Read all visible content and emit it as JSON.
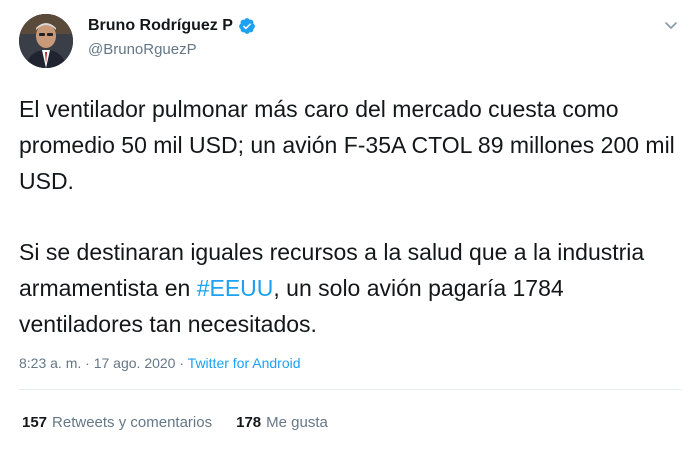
{
  "author": {
    "display_name": "Bruno Rodríguez P",
    "handle": "@BrunoRguezP"
  },
  "tweet": {
    "paragraph1": "El ventilador pulmonar más caro del mercado cuesta como promedio 50 mil USD; un avión F-35A CTOL 89 millones 200 mil USD.",
    "paragraph2_before": "Si se destinaran iguales recursos a la salud que a la industria armamentista en ",
    "hashtag": "#EEUU",
    "paragraph2_after": ", un solo avión pagaría 1784 ventiladores tan necesitados."
  },
  "meta": {
    "time": "8:23 a. m.",
    "separator1": " · ",
    "date": "17 ago. 2020",
    "separator2": " · ",
    "source": "Twitter for Android"
  },
  "stats": {
    "retweets_count": "157",
    "retweets_label": "Retweets y comentarios",
    "likes_count": "178",
    "likes_label": "Me gusta"
  },
  "colors": {
    "link": "#1da1f2",
    "secondary_text": "#657786",
    "verified": "#1da1f2"
  },
  "icons": {
    "verified": "verified-badge-icon",
    "caret": "chevron-down-icon"
  }
}
